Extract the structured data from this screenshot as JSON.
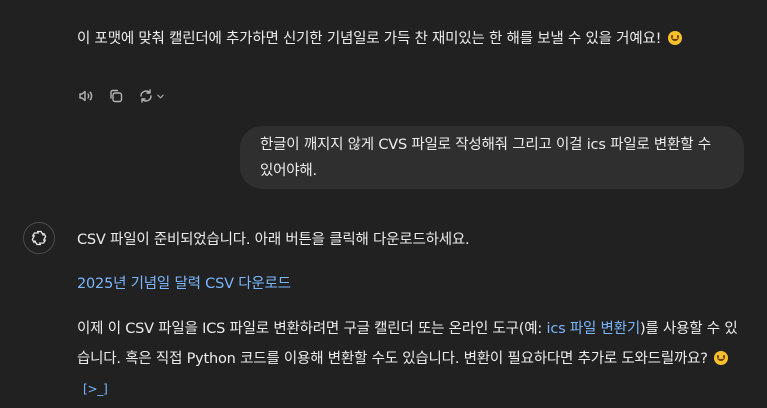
{
  "assistant_prev": {
    "line": "이 포맷에 맞춰 캘린더에 추가하면 신기한 기념일로 가득 찬 재미있는 한 해를 보낼 수 있을 거예요!"
  },
  "actions": {
    "icons": [
      "speaker-icon",
      "copy-icon",
      "regenerate-icon",
      "chevron-down-icon"
    ]
  },
  "user_message": {
    "text": "한글이 깨지지 않게 CVS 파일로 작성해줘 그리고 이걸 ics 파일로 변환할 수 있어야해."
  },
  "assistant": {
    "para1": "CSV 파일이 준비되었습니다. 아래 버튼을 클릭해 다운로드하세요.",
    "download_link": "2025년 기념일 달력 CSV 다운로드",
    "para2_before": "이제 이 CSV 파일을 ICS 파일로 변환하려면 구글 캘린더 또는 온라인 도구(예: ",
    "para2_link": "ics 파일 변환기",
    "para2_after": ")를 사용할 수 있습니다. 혹은 직접 Python 코드를 이용해 변환할 수도 있습니다. 변환이 필요하다면 추가로 도와드릴까요?",
    "cite_glyph": "[>_]"
  },
  "colors": {
    "background": "#212121",
    "bubble": "#2f2f2f",
    "text": "#ececec",
    "link": "#7ab7ff"
  }
}
